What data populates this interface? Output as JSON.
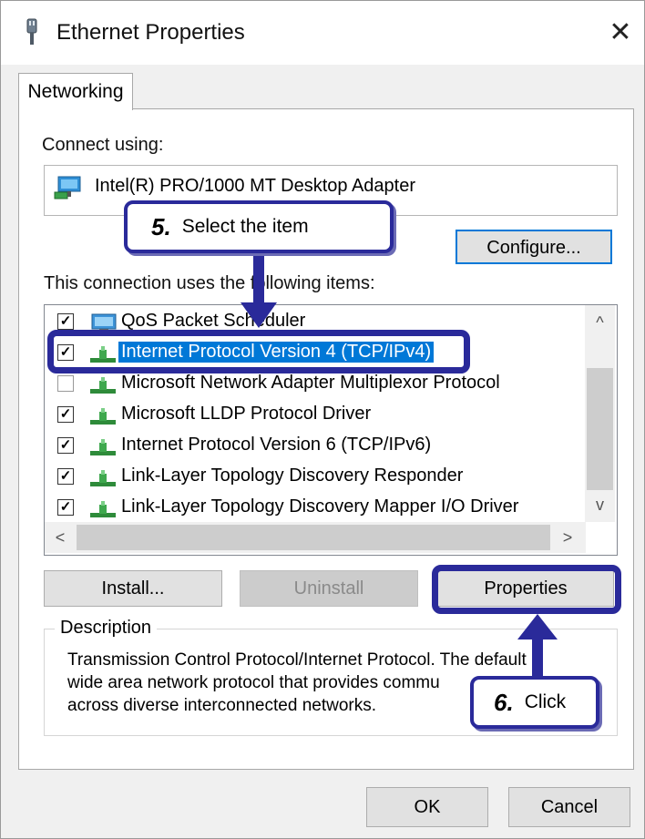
{
  "window": {
    "title": "Ethernet Properties",
    "close_glyph": "✕"
  },
  "tabs": [
    {
      "label": "Networking",
      "active": true
    }
  ],
  "connect_using": {
    "label": "Connect using:",
    "adapter_name": "Intel(R) PRO/1000 MT Desktop Adapter",
    "configure_label": "Configure..."
  },
  "items_list": {
    "label": "This connection uses the following items:",
    "items": [
      {
        "label": "QoS Packet Scheduler",
        "checked": true,
        "icon": "qos-monitor-icon",
        "selected": false
      },
      {
        "label": "Internet Protocol Version 4 (TCP/IPv4)",
        "checked": true,
        "icon": "protocol-icon",
        "selected": true
      },
      {
        "label": "Microsoft Network Adapter Multiplexor Protocol",
        "checked": false,
        "icon": "protocol-icon",
        "selected": false
      },
      {
        "label": "Microsoft LLDP Protocol Driver",
        "checked": true,
        "icon": "protocol-icon",
        "selected": false
      },
      {
        "label": "Internet Protocol Version 6 (TCP/IPv6)",
        "checked": true,
        "icon": "protocol-icon",
        "selected": false
      },
      {
        "label": "Link-Layer Topology Discovery Responder",
        "checked": true,
        "icon": "protocol-icon",
        "selected": false
      },
      {
        "label": "Link-Layer Topology Discovery Mapper I/O Driver",
        "checked": true,
        "icon": "protocol-icon",
        "selected": false
      }
    ],
    "scroll_up": "^",
    "scroll_down": "v",
    "scroll_left": "<",
    "scroll_right": ">"
  },
  "buttons": {
    "install": "Install...",
    "uninstall": "Uninstall",
    "properties": "Properties",
    "ok": "OK",
    "cancel": "Cancel"
  },
  "description": {
    "title": "Description",
    "line1": "Transmission Control Protocol/Internet Protocol. The default",
    "line2": "wide area network protocol that provides commu",
    "line3": "across diverse interconnected networks."
  },
  "callouts": {
    "step5": {
      "number": "5.",
      "text": "Select the item"
    },
    "step6": {
      "number": "6.",
      "text": "Click"
    }
  },
  "colors": {
    "callout": "#2a2a9a",
    "selection": "#0078d7",
    "dialog_bg": "#f0f0f0"
  }
}
